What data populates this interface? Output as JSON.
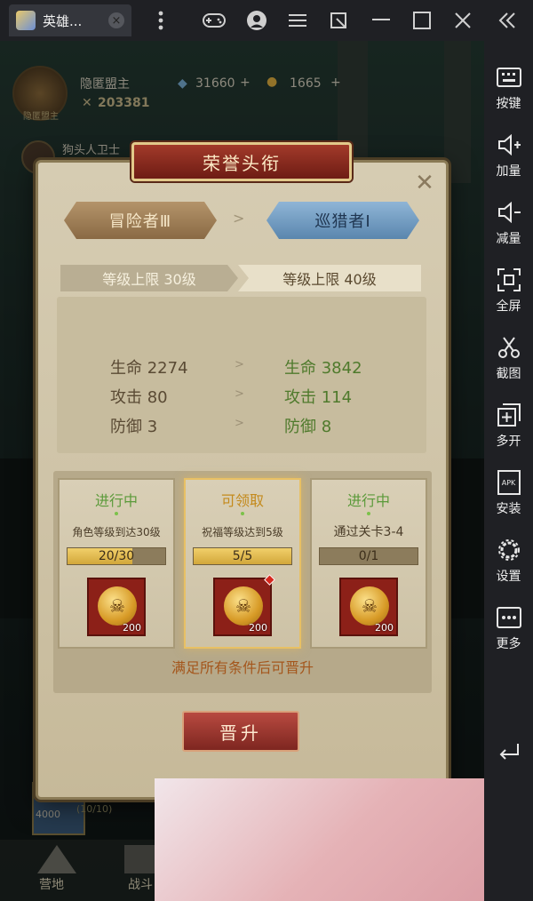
{
  "emulator": {
    "tab_title": "英雄...",
    "tab_close": "×",
    "toolbar_icons": [
      "gamepad-icon",
      "user-icon",
      "menu-icon",
      "resize-icon",
      "minimize-icon",
      "maximize-icon",
      "close-icon",
      "collapse-icon"
    ]
  },
  "sidebar": {
    "items": [
      {
        "label": "按键",
        "icon": "keyboard-icon"
      },
      {
        "label": "加量",
        "icon": "volume-up-icon"
      },
      {
        "label": "减量",
        "icon": "volume-down-icon"
      },
      {
        "label": "全屏",
        "icon": "fullscreen-icon"
      },
      {
        "label": "截图",
        "icon": "scissors-icon"
      },
      {
        "label": "多开",
        "icon": "multi-instance-icon"
      },
      {
        "label": "安装",
        "icon": "apk-icon"
      },
      {
        "label": "设置",
        "icon": "gear-icon"
      },
      {
        "label": "更多",
        "icon": "more-icon"
      }
    ],
    "apk_text": "APK"
  },
  "hud": {
    "player_name": "隐匿盟主",
    "combat_power": "203381",
    "gems": "31660",
    "gold": "1665",
    "guard_name": "狗头人卫士",
    "level_tag": "隐匿盟主"
  },
  "dialog": {
    "title": "荣誉头衔",
    "current_rank": "冒险者Ⅲ",
    "next_rank": "巡猎者Ⅰ",
    "arrow": ">",
    "current_level_cap": "等级上限 30级",
    "next_level_cap": "等级上限 40级",
    "stats": [
      {
        "old": "生命 2274",
        "new": "生命 3842"
      },
      {
        "old": "攻击 80",
        "new": "攻击 114"
      },
      {
        "old": "防御 3",
        "new": "防御 8"
      }
    ],
    "tasks": [
      {
        "status": "进行中",
        "desc": "角色等级到达30级",
        "progress": "20/30",
        "progress_value": 0.667,
        "reward_qty": "200",
        "claimable": false
      },
      {
        "status": "可领取",
        "desc": "祝福等级达到5级",
        "progress": "5/5",
        "progress_value": 1.0,
        "reward_qty": "200",
        "claimable": true
      },
      {
        "status": "进行中",
        "desc": "通过关卡3-4",
        "progress": "0/1",
        "progress_value": 0.0,
        "reward_qty": "200",
        "claimable": false
      }
    ],
    "condition_text": "满足所有条件后可晋升",
    "promote_button": "晋升"
  },
  "bottom": {
    "base_label": "营地",
    "battle_label": "战斗",
    "chest_count": "4000",
    "chest_progress": "(10/10)"
  },
  "colors": {
    "accent_red": "#8c2018",
    "rank_blue": "#8fb5d6",
    "status_green": "#5b9a3a",
    "status_gold": "#c48a1c"
  }
}
